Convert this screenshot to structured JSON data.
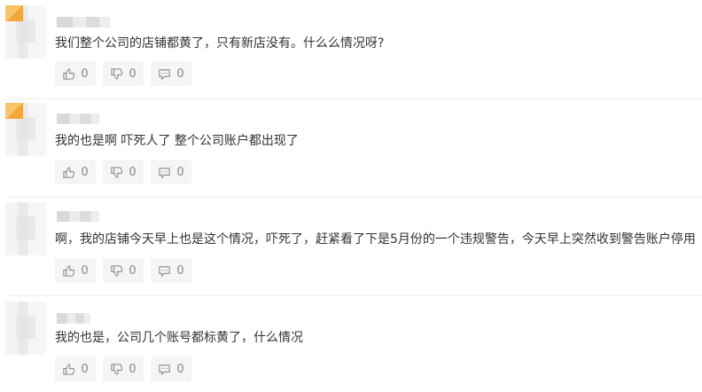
{
  "comments": [
    {
      "text": "我们整个公司的店铺都黄了，只有新店没有。什么么情况呀?",
      "likes": "0",
      "dislikes": "0",
      "replies": "0"
    },
    {
      "text": "我的也是啊  吓死人了  整个公司账户都出现了",
      "likes": "0",
      "dislikes": "0",
      "replies": "0"
    },
    {
      "text": "啊，我的店铺今天早上也是这个情况，吓死了，赶紧看了下是5月份的一个违规警告，今天早上突然收到警告账户停用",
      "likes": "0",
      "dislikes": "0",
      "replies": "0"
    },
    {
      "text": "我的也是，公司几个账号都标黄了，什么情况",
      "likes": "0",
      "dislikes": "0",
      "replies": "0"
    }
  ],
  "colors": {
    "badge": "#f3a73c",
    "text": "#333333",
    "muted": "#888888",
    "button_bg": "#f5f5f5"
  },
  "icons": [
    "thumbs-up-icon",
    "thumbs-down-icon",
    "comment-icon"
  ]
}
